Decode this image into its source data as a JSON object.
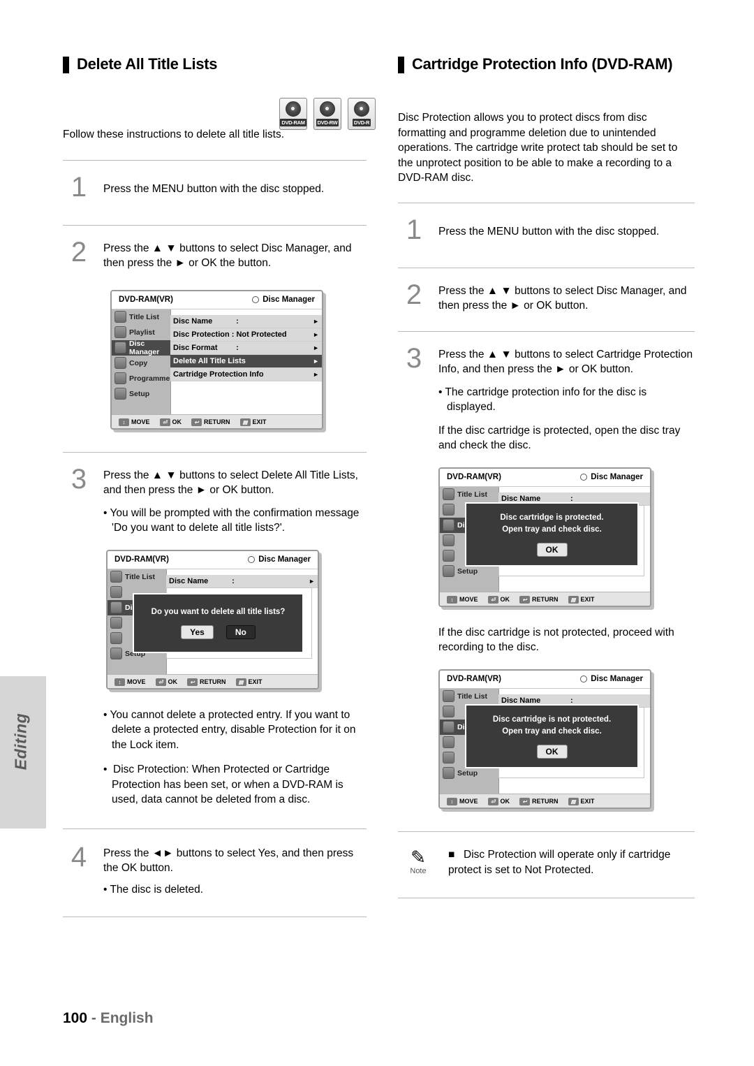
{
  "page": {
    "number": "100",
    "language": "English",
    "side_tab": "Editing"
  },
  "left": {
    "title": "Delete All Title Lists",
    "discs": [
      {
        "label": "DVD-RAM",
        "name": "dvd-ram-disc-icon"
      },
      {
        "label": "DVD-RW",
        "name": "dvd-rw-disc-icon"
      },
      {
        "label": "DVD-R",
        "name": "dvd-r-disc-icon"
      }
    ],
    "intro": "Follow these instructions to delete all title lists.",
    "steps": [
      {
        "num": "1",
        "text": "Press the MENU button with the disc stopped."
      },
      {
        "num": "2",
        "text": "Press the ▲ ▼ buttons to select Disc Manager, and then press the ► or OK the button."
      },
      {
        "num": "3",
        "text": "Press the ▲ ▼ buttons to select Delete All Title Lists, and then press the ► or OK button.",
        "bullets": [
          "You will be prompted with the confirmation message 'Do you want to delete all title lists?'."
        ]
      },
      {
        "num": "4",
        "text": "Press the ◄► buttons to select Yes, and then press the OK button.",
        "bullets": [
          "The disc is deleted."
        ]
      }
    ],
    "after_bullets": [
      "You cannot delete a protected entry. If you want to delete a protected entry, disable Protection for it on the Lock item.",
      "Disc Protection: When Protected or Cartridge Protection has been set, or when a DVD-RAM is used, data cannot be deleted from a disc."
    ],
    "osd_menu": {
      "disc_type": "DVD-RAM(VR)",
      "menu_title": "Disc Manager",
      "side_items": [
        {
          "label": "Title List",
          "selected": false
        },
        {
          "label": "Playlist",
          "selected": false
        },
        {
          "label": "Disc Manager",
          "selected": true
        },
        {
          "label": "Copy",
          "selected": false
        },
        {
          "label": "Programme",
          "selected": false
        },
        {
          "label": "Setup",
          "selected": false
        }
      ],
      "rows": [
        {
          "label": "Disc Name",
          "value": ":",
          "selected": false,
          "arrow": "►"
        },
        {
          "label": "Disc Protection : Not Protected",
          "value": "",
          "selected": false,
          "arrow": "►"
        },
        {
          "label": "Disc Format",
          "value": ":",
          "selected": false,
          "arrow": "►"
        },
        {
          "label": "Delete All Title Lists",
          "value": "",
          "selected": true,
          "arrow": "►"
        },
        {
          "label": "Cartridge Protection Info",
          "value": "",
          "selected": false,
          "arrow": "►"
        }
      ],
      "footer": [
        {
          "key": "↕",
          "label": "MOVE"
        },
        {
          "key": "⏎",
          "label": "OK"
        },
        {
          "key": "↩",
          "label": "RETURN"
        },
        {
          "key": "▤",
          "label": "EXIT"
        }
      ]
    },
    "osd_confirm": {
      "disc_type": "DVD-RAM(VR)",
      "menu_title": "Disc Manager",
      "row_label": "Title List",
      "row_value": "Disc Name",
      "row_colon": ":",
      "side_sel": "Disc",
      "bottom_item": "Setup",
      "dialog_line": "Do you want to delete all title lists?",
      "yes": "Yes",
      "no": "No",
      "footer": [
        {
          "key": "↕",
          "label": "MOVE"
        },
        {
          "key": "⏎",
          "label": "OK"
        },
        {
          "key": "↩",
          "label": "RETURN"
        },
        {
          "key": "▤",
          "label": "EXIT"
        }
      ]
    }
  },
  "right": {
    "title": "Cartridge Protection Info (DVD-RAM)",
    "intro": "Disc Protection allows you to protect discs from disc formatting and programme deletion due to unintended operations. The cartridge write protect tab should be set to the unprotect position to be able to make a recording to a DVD-RAM disc.",
    "steps": [
      {
        "num": "1",
        "text": "Press the MENU button with the disc stopped."
      },
      {
        "num": "2",
        "text": "Press the ▲ ▼ buttons to select Disc Manager, and then press the ► or OK button."
      },
      {
        "num": "3",
        "text": "Press the ▲ ▼ buttons to select Cartridge Protection Info, and then press the ► or OK button.",
        "bullets": [
          "The cartridge protection info for the disc is displayed."
        ],
        "after": "If the disc cartridge is protected, open the disc tray and check the disc."
      }
    ],
    "mid_text": "If the disc cartridge is not protected, proceed with recording to the disc.",
    "osd_protected": {
      "disc_type": "DVD-RAM(VR)",
      "menu_title": "Disc Manager",
      "row_label": "Title List",
      "row_value": "Disc Name",
      "row_colon": ":",
      "side_sel": "Dis",
      "bottom_item": "Setup",
      "dialog_line1": "Disc cartridge is protected.",
      "dialog_line2": "Open tray and check disc.",
      "ok": "OK",
      "footer": [
        {
          "key": "↕",
          "label": "MOVE"
        },
        {
          "key": "⏎",
          "label": "OK"
        },
        {
          "key": "↩",
          "label": "RETURN"
        },
        {
          "key": "▤",
          "label": "EXIT"
        }
      ]
    },
    "osd_not_protected": {
      "disc_type": "DVD-RAM(VR)",
      "menu_title": "Disc Manager",
      "row_label": "Title List",
      "row_value": "Disc Name",
      "row_colon": ":",
      "side_sel": "Disc",
      "bottom_item": "Setup",
      "dialog_line1": "Disc cartridge is not protected.",
      "dialog_line2": "Open tray and check disc.",
      "ok": "OK",
      "footer": [
        {
          "key": "↕",
          "label": "MOVE"
        },
        {
          "key": "⏎",
          "label": "OK"
        },
        {
          "key": "↩",
          "label": "RETURN"
        },
        {
          "key": "▤",
          "label": "EXIT"
        }
      ]
    },
    "note": {
      "caption": "Note",
      "bullet": "■",
      "text": "Disc Protection will operate only if cartridge protect is set to Not Protected."
    }
  }
}
